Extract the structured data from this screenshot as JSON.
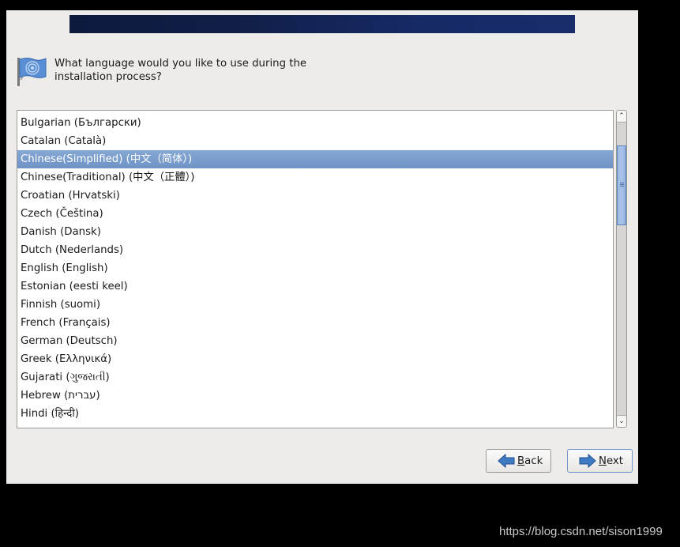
{
  "prompt": {
    "icon": "language-flag-icon",
    "text_line1": "What language would you like to use during the",
    "text_line2": "installation process?"
  },
  "languages": [
    {
      "label": "Bulgarian (Български)",
      "selected": false
    },
    {
      "label": "Catalan (Català)",
      "selected": false
    },
    {
      "label": "Chinese(Simplified) (中文（简体）)",
      "selected": true
    },
    {
      "label": "Chinese(Traditional) (中文（正體）)",
      "selected": false
    },
    {
      "label": "Croatian (Hrvatski)",
      "selected": false
    },
    {
      "label": "Czech (Čeština)",
      "selected": false
    },
    {
      "label": "Danish (Dansk)",
      "selected": false
    },
    {
      "label": "Dutch (Nederlands)",
      "selected": false
    },
    {
      "label": "English (English)",
      "selected": false
    },
    {
      "label": "Estonian (eesti keel)",
      "selected": false
    },
    {
      "label": "Finnish (suomi)",
      "selected": false
    },
    {
      "label": "French (Français)",
      "selected": false
    },
    {
      "label": "German (Deutsch)",
      "selected": false
    },
    {
      "label": "Greek (Ελληνικά)",
      "selected": false
    },
    {
      "label": "Gujarati (ગુજરાતી)",
      "selected": false
    },
    {
      "label": "Hebrew (עברית)",
      "selected": false
    },
    {
      "label": "Hindi (हिन्दी)",
      "selected": false
    }
  ],
  "scrollbar": {
    "position_fraction": 0.12,
    "visible_fraction": 0.27
  },
  "buttons": {
    "back": {
      "mnemonic": "B",
      "rest": "ack",
      "icon": "arrow-left-icon"
    },
    "next": {
      "mnemonic": "N",
      "rest": "ext",
      "icon": "arrow-right-icon"
    }
  },
  "watermark": "https://blog.csdn.net/sison1999",
  "colors": {
    "selection": "#7a9cce",
    "banner": "#162a66",
    "arrow": "#2f6cb5"
  }
}
